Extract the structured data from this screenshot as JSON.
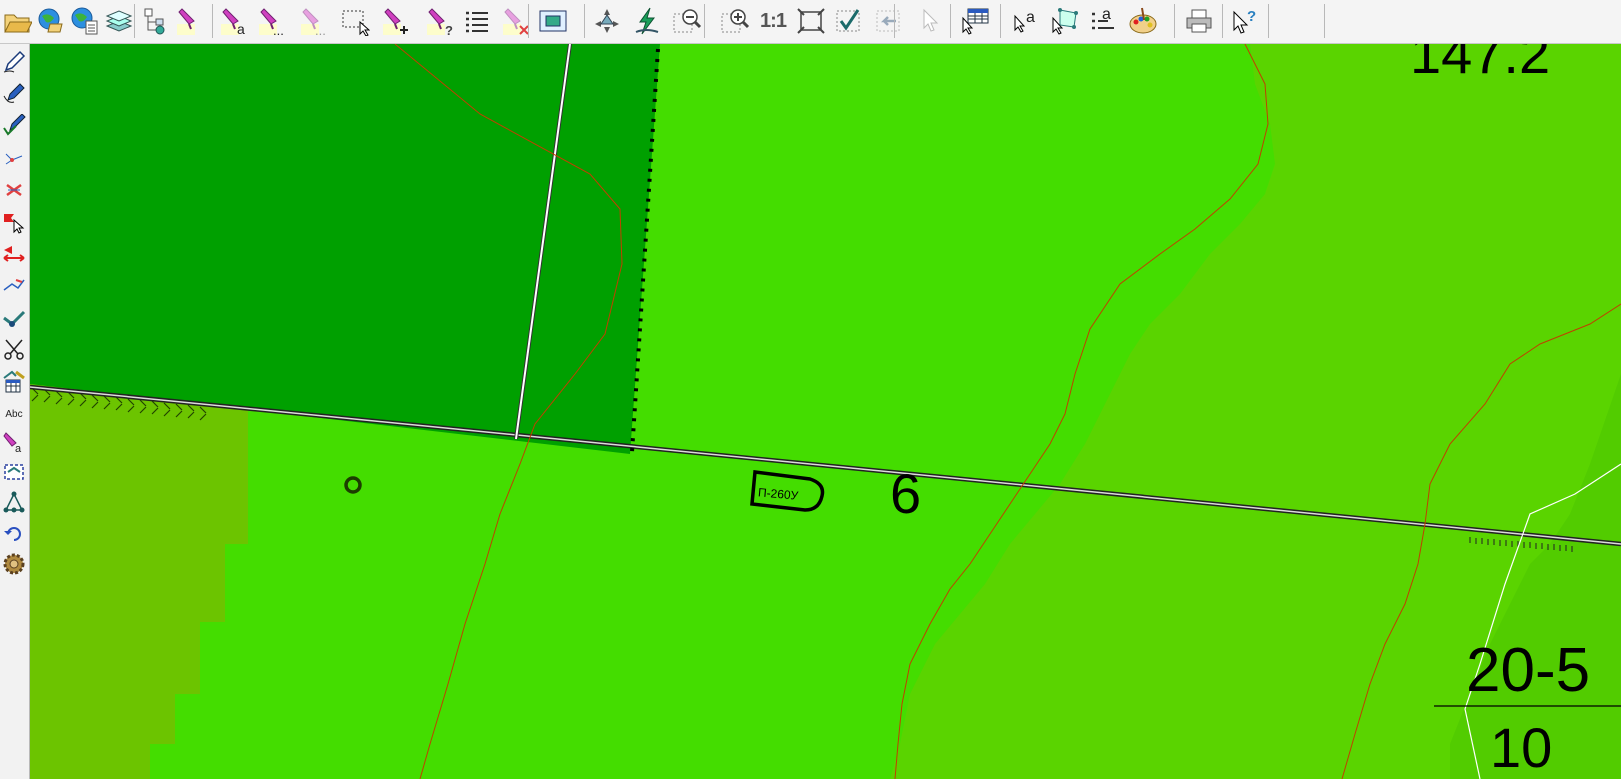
{
  "toolbar": {
    "buttons": [
      {
        "id": "open",
        "icon": "open-folder-icon"
      },
      {
        "id": "globe",
        "icon": "globe-layers-icon"
      },
      {
        "id": "globe-props",
        "icon": "globe-list-icon"
      },
      {
        "id": "layers",
        "icon": "layers-icon"
      },
      {
        "id": "tree",
        "icon": "tree-structure-icon"
      },
      {
        "id": "marker",
        "icon": "marker-icon"
      },
      {
        "id": "marker-text",
        "icon": "marker-text-icon",
        "sub": "a"
      },
      {
        "id": "marker-more",
        "icon": "marker-more-icon",
        "sub": "..."
      },
      {
        "id": "marker-faded",
        "icon": "marker-faded-icon",
        "sub": "..."
      },
      {
        "id": "select-rect",
        "icon": "select-rectangle-icon"
      },
      {
        "id": "marker-add",
        "icon": "marker-add-icon"
      },
      {
        "id": "marker-query",
        "icon": "marker-query-icon"
      },
      {
        "id": "list",
        "icon": "list-icon"
      },
      {
        "id": "marker-delete",
        "icon": "marker-delete-icon"
      },
      {
        "id": "frame",
        "icon": "frame-view-icon"
      },
      {
        "id": "navigate",
        "icon": "navigate-icon"
      },
      {
        "id": "refresh",
        "icon": "lightning-icon"
      },
      {
        "id": "zoom-out",
        "icon": "zoom-out-icon"
      },
      {
        "id": "zoom-in",
        "icon": "zoom-in-icon"
      },
      {
        "id": "zoom-1-1",
        "icon": "zoom-actual-icon",
        "text": "1:1"
      },
      {
        "id": "zoom-fit",
        "icon": "zoom-fit-icon"
      },
      {
        "id": "check-extent",
        "icon": "check-extent-icon"
      },
      {
        "id": "back-extent",
        "icon": "back-extent-icon"
      },
      {
        "id": "pointer",
        "icon": "pointer-icon"
      },
      {
        "id": "table",
        "icon": "table-icon"
      },
      {
        "id": "select-text",
        "icon": "select-text-icon"
      },
      {
        "id": "select-polygon",
        "icon": "select-polygon-icon"
      },
      {
        "id": "attribute-list",
        "icon": "attribute-list-icon"
      },
      {
        "id": "palette",
        "icon": "palette-icon"
      },
      {
        "id": "print",
        "icon": "printer-icon"
      },
      {
        "id": "help",
        "icon": "help-pointer-icon"
      }
    ]
  },
  "sidebar": {
    "buttons": [
      {
        "icon": "pencil-icon"
      },
      {
        "icon": "pencil-curve-icon"
      },
      {
        "icon": "pencil-check-icon"
      },
      {
        "icon": "vertex-edit-icon"
      },
      {
        "icon": "delete-vertex-icon"
      },
      {
        "icon": "flag-pointer-icon"
      },
      {
        "icon": "move-horizontal-icon"
      },
      {
        "icon": "edit-line-icon"
      },
      {
        "icon": "move-node-icon"
      },
      {
        "icon": "scissors-icon"
      },
      {
        "icon": "table-edit-icon"
      },
      {
        "icon": "label-text-icon",
        "text": "Abc"
      },
      {
        "icon": "marker-label-icon"
      },
      {
        "icon": "select-dashed-icon"
      },
      {
        "icon": "network-icon"
      },
      {
        "icon": "undo-icon"
      },
      {
        "icon": "settings-gear-icon"
      }
    ]
  },
  "map": {
    "labels": {
      "elevation": "147.2",
      "parcel_number": "6",
      "block_code": "20-5",
      "block_code_lower": "10",
      "feature_tag": "П-260У"
    },
    "colors": {
      "dark_forest": "#00a000",
      "bright_green": "#44dd00",
      "mid_green": "#5ad400",
      "olive_green": "#6cc400",
      "contour_line": "#c04000",
      "road_white": "#ffffff",
      "boundary_black": "#000000"
    }
  }
}
